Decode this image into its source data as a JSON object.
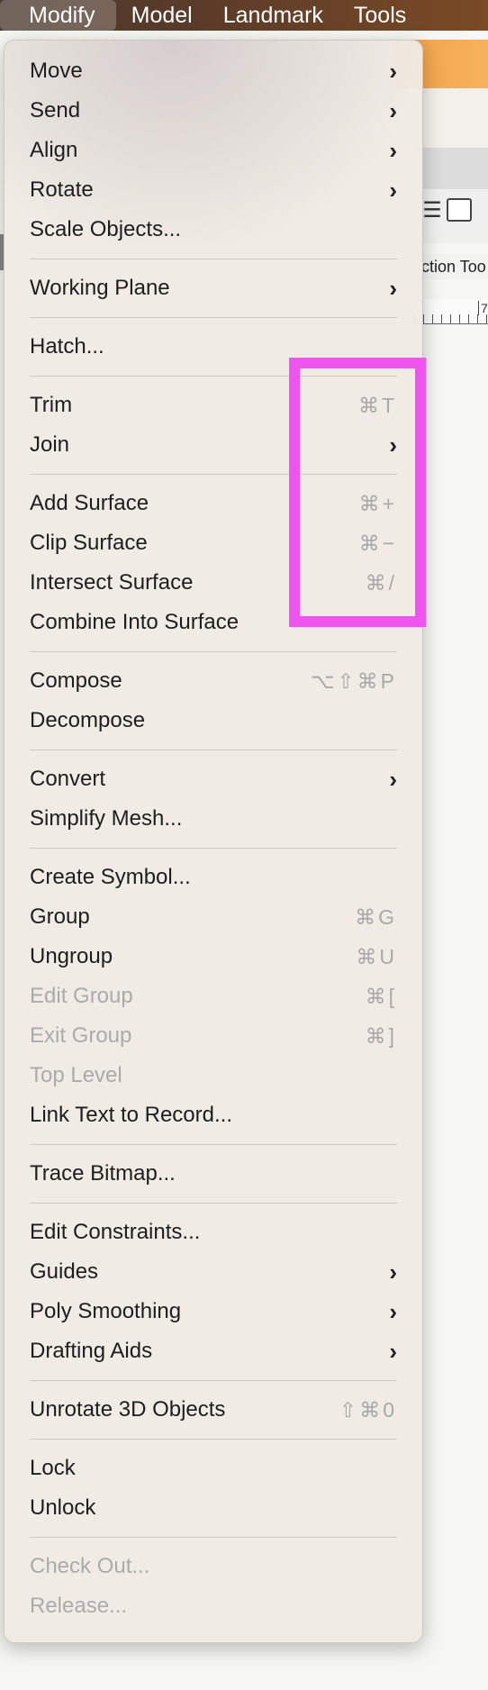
{
  "menubar": {
    "items": [
      {
        "label": "Modify",
        "active": true
      },
      {
        "label": "Model",
        "active": false
      },
      {
        "label": "Landmark",
        "active": false
      },
      {
        "label": "Tools",
        "active": false
      }
    ]
  },
  "background": {
    "tool_text": "ction Too",
    "ruler_number": "7",
    "layers_glyph": "☰"
  },
  "menu": {
    "groups": [
      [
        {
          "label": "Move",
          "submenu": true
        },
        {
          "label": "Send",
          "submenu": true
        },
        {
          "label": "Align",
          "submenu": true
        },
        {
          "label": "Rotate",
          "submenu": true
        },
        {
          "label": "Scale Objects..."
        }
      ],
      [
        {
          "label": "Working Plane",
          "submenu": true
        }
      ],
      [
        {
          "label": "Hatch..."
        }
      ],
      [
        {
          "label": "Trim",
          "shortcut": "⌘T"
        },
        {
          "label": "Join",
          "submenu": true
        }
      ],
      [
        {
          "label": "Add Surface",
          "shortcut": "⌘+"
        },
        {
          "label": "Clip Surface",
          "shortcut": "⌘−"
        },
        {
          "label": "Intersect Surface",
          "shortcut": "⌘/"
        },
        {
          "label": "Combine Into Surface"
        }
      ],
      [
        {
          "label": "Compose",
          "shortcut": "⌥⇧⌘P"
        },
        {
          "label": "Decompose"
        }
      ],
      [
        {
          "label": "Convert",
          "submenu": true
        },
        {
          "label": "Simplify Mesh..."
        }
      ],
      [
        {
          "label": "Create Symbol..."
        },
        {
          "label": "Group",
          "shortcut": "⌘G"
        },
        {
          "label": "Ungroup",
          "shortcut": "⌘U"
        },
        {
          "label": "Edit Group",
          "shortcut": "⌘[",
          "disabled": true
        },
        {
          "label": "Exit Group",
          "shortcut": "⌘]",
          "disabled": true
        },
        {
          "label": "Top Level",
          "disabled": true
        },
        {
          "label": "Link Text to Record..."
        }
      ],
      [
        {
          "label": "Trace Bitmap..."
        }
      ],
      [
        {
          "label": "Edit Constraints..."
        },
        {
          "label": "Guides",
          "submenu": true
        },
        {
          "label": "Poly Smoothing",
          "submenu": true
        },
        {
          "label": "Drafting Aids",
          "submenu": true
        }
      ],
      [
        {
          "label": "Unrotate 3D Objects",
          "shortcut": "⇧⌘0"
        }
      ],
      [
        {
          "label": "Lock"
        },
        {
          "label": "Unlock"
        }
      ],
      [
        {
          "label": "Check Out...",
          "disabled": true
        },
        {
          "label": "Release...",
          "disabled": true
        }
      ]
    ],
    "chevron_glyph": "›"
  },
  "colors": {
    "highlight": "#ee55ee",
    "disabled_text": "#ababab",
    "menu_background": "#f0eae4"
  }
}
